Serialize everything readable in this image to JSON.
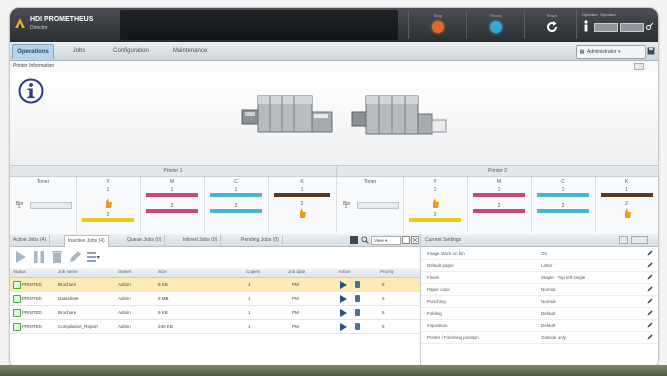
{
  "app": {
    "title": "HDI PROMETHEUS",
    "subtitle": "Director"
  },
  "topbar": {
    "buttons": [
      {
        "label": "Stop",
        "icon": "stop-icon",
        "color": "#e06a2c"
      },
      {
        "label": "Ready",
        "icon": "ready-icon",
        "color": "#38a8d8"
      },
      {
        "label": "Reset",
        "icon": "refresh-icon",
        "color": "#ffffff"
      }
    ],
    "user_label": "Operator: Operator"
  },
  "nav": {
    "tabs": [
      "Operations",
      "Jobs",
      "Configuration",
      "Maintenance"
    ],
    "active_tab": "Operations",
    "mode_select": "Administrator"
  },
  "printer_info": {
    "header": "Printer Information"
  },
  "printers": [
    {
      "title": "Printer 1",
      "status_label": "Toner",
      "bin_label": "Bin",
      "bin_value": "1",
      "toners": [
        {
          "label": "Y",
          "value_top": "1",
          "value_bottom": "2",
          "color": "#f0c81e"
        },
        {
          "label": "M",
          "value_top": "1",
          "value_bottom": "2",
          "color": "#c9457e"
        },
        {
          "label": "C",
          "value_top": "1",
          "value_bottom": "2",
          "color": "#49b5d6"
        },
        {
          "label": "K",
          "value_top": "1",
          "value_bottom": "2",
          "color": "#5a3a22"
        }
      ]
    },
    {
      "title": "Printer 2",
      "status_label": "Toner",
      "bin_label": "Bin",
      "bin_value": "1",
      "toners": [
        {
          "label": "Y",
          "value_top": "1",
          "value_bottom": "2",
          "color": "#f0c81e"
        },
        {
          "label": "M",
          "value_top": "1",
          "value_bottom": "2",
          "color": "#c9457e"
        },
        {
          "label": "C",
          "value_top": "1",
          "value_bottom": "2",
          "color": "#49b5d6"
        },
        {
          "label": "K",
          "value_top": "1",
          "value_bottom": "2",
          "color": "#5a3a22"
        }
      ]
    }
  ],
  "jobs": {
    "tabs": [
      "Active Jobs (4)",
      "Inactive Jobs (4)",
      "Queue Jobs (0)",
      "Inlined Jobs (0)",
      "Pending Jobs (0)"
    ],
    "active_tab": "Inactive Jobs (4)",
    "view_select": "View",
    "columns": [
      "Status",
      "Job name",
      "Owner",
      "Size",
      "Copies",
      "Job date",
      "Action",
      "Priority"
    ],
    "rows": [
      {
        "status": "PRINTED",
        "name": "Brochure",
        "owner": "Admin",
        "size": "8 KB",
        "copies": "1",
        "date": "PM",
        "priority": "5",
        "selected": true
      },
      {
        "status": "PRINTED",
        "name": "Datasheet",
        "owner": "Admin",
        "size": "9 MB",
        "copies": "1",
        "date": "PM",
        "priority": "5",
        "selected": false
      },
      {
        "status": "PRINTED",
        "name": "Brochure",
        "owner": "Admin",
        "size": "8 KB",
        "copies": "1",
        "date": "PM",
        "priority": "5",
        "selected": false
      },
      {
        "status": "PRINTED",
        "name": "Compliance_Report",
        "owner": "Admin",
        "size": "240 KB",
        "copies": "1",
        "date": "PM",
        "priority": "5",
        "selected": false
      }
    ]
  },
  "settings": {
    "header": "Current Settings",
    "rows": [
      {
        "key": "Image stack on bin",
        "value": "On"
      },
      {
        "key": "Default paper",
        "value": "Letter"
      },
      {
        "key": "Finish",
        "value": "Staple - Top left single"
      },
      {
        "key": "Paper color",
        "value": "Normal"
      },
      {
        "key": "Punching",
        "value": "Normal"
      },
      {
        "key": "Folding",
        "value": "Default"
      },
      {
        "key": "Imposition",
        "value": "Default"
      },
      {
        "key": "Printer / Finishing position",
        "value": "Outside only"
      }
    ]
  },
  "colors": {
    "accent": "#b9d4ea",
    "selected_row": "#fdebb3",
    "ok_green": "#3fae3f",
    "action_blue": "#24527e"
  }
}
